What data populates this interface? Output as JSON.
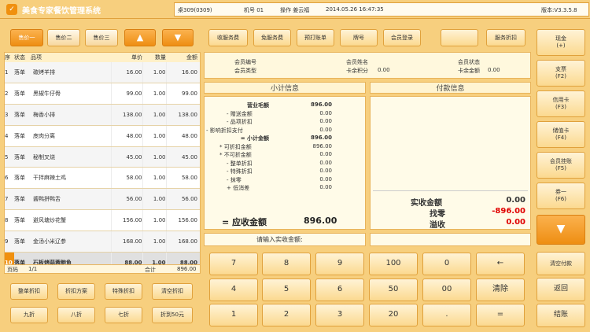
{
  "app": {
    "title": "美食专家餐饮管理系统",
    "table": "桌309(0309)",
    "machine": "机号 01",
    "operator": "操作 姜云福",
    "datetime": "2014.05.26 16:47:35",
    "version": "版本:V3.3.5.8"
  },
  "price_buttons": [
    "售价一",
    "售价二",
    "售价三"
  ],
  "order_table": {
    "headers": [
      "序",
      "状态",
      "品项",
      "单价",
      "数量",
      "金额"
    ],
    "rows": [
      [
        "1",
        "落单",
        "碳烤羊排",
        "16.00",
        "1.00",
        "16.00"
      ],
      [
        "2",
        "落单",
        "黑椒牛仔骨",
        "99.00",
        "1.00",
        "99.00"
      ],
      [
        "3",
        "落单",
        "梅香小排",
        "138.00",
        "1.00",
        "138.00"
      ],
      [
        "4",
        "落单",
        "庋肉分离",
        "48.00",
        "1.00",
        "48.00"
      ],
      [
        "5",
        "落单",
        "秘制叉烧",
        "45.00",
        "1.00",
        "45.00"
      ],
      [
        "6",
        "落单",
        "干拌麻辣土鸡",
        "58.00",
        "1.00",
        "58.00"
      ],
      [
        "7",
        "落单",
        "酱鸭拼鸭舌",
        "56.00",
        "1.00",
        "56.00"
      ],
      [
        "8",
        "落单",
        "避风塘炒花蟹",
        "156.00",
        "1.00",
        "156.00"
      ],
      [
        "9",
        "落单",
        "金汤小米辽参",
        "168.00",
        "1.00",
        "168.00"
      ],
      [
        "10",
        "落单",
        "石板烤蒜蓉鲍鱼",
        "88.00",
        "1.00",
        "88.00"
      ]
    ],
    "footer": {
      "page_label": "页码",
      "page": "1/1",
      "total_label": "合计",
      "total": "896.00"
    }
  },
  "left_actions": [
    [
      "整单折扣",
      "折扣方案",
      "特殊折扣",
      "清空折扣"
    ],
    [
      "九折",
      "八折",
      "七折",
      "折到50元"
    ]
  ],
  "top_buttons": [
    "收服务费",
    "免服务费",
    "预打账单",
    "牌号",
    "会员登录",
    "",
    "服务折扣"
  ],
  "member": {
    "no_label": "会员编号",
    "type_label": "会员类型",
    "name_label": "会员姓名",
    "points_label": "卡余积分",
    "points": "0.00",
    "status_label": "会员状态",
    "balance_label": "卡余金额",
    "balance": "0.00"
  },
  "subtotal": {
    "title": "小计信息",
    "lines": [
      [
        "营业毛额",
        "896.00"
      ],
      [
        "- 赠送金额",
        "0.00"
      ],
      [
        "- 品项折扣",
        "0.00"
      ],
      [
        "- 影响折扣支付",
        "0.00"
      ],
      [
        "= 小计金额",
        "896.00"
      ],
      [
        "* 可折扣金额",
        "896.00"
      ],
      [
        "* 不可折金额",
        "0.00"
      ],
      [
        "- 整单折扣",
        "0.00"
      ],
      [
        "- 特殊折扣",
        "0.00"
      ],
      [
        "- 抹零",
        "0.00"
      ],
      [
        "+ 低消差",
        "0.00"
      ]
    ],
    "due_label": "= 应收金额",
    "due": "896.00"
  },
  "payment": {
    "title": "付款信息",
    "received_label": "实收金额",
    "received": "0.00",
    "change_label": "找零",
    "change": "-896.00",
    "balance_label": "溢收",
    "balance": "0.00"
  },
  "input_prompt": "请输入实收金额:",
  "keypad": [
    [
      "7",
      "8",
      "9",
      "100",
      "0",
      "←"
    ],
    [
      "4",
      "5",
      "6",
      "50",
      "00",
      "清除"
    ],
    [
      "1",
      "2",
      "3",
      "20",
      ".",
      "="
    ]
  ],
  "payment_methods": [
    {
      "label": "现金",
      "key": "(+)"
    },
    {
      "label": "支票",
      "key": "(F2)"
    },
    {
      "label": "信用卡",
      "key": "(F3)"
    },
    {
      "label": "储值卡",
      "key": "(F4)"
    },
    {
      "label": "会员挂账",
      "key": "(F5)"
    },
    {
      "label": "券一",
      "key": "(F6)"
    }
  ],
  "right_actions": [
    "清空付款",
    "返回",
    "结账"
  ],
  "colors": {
    "accent": "#f0900f",
    "red": "#e00000",
    "panel": "#fff8dd"
  }
}
